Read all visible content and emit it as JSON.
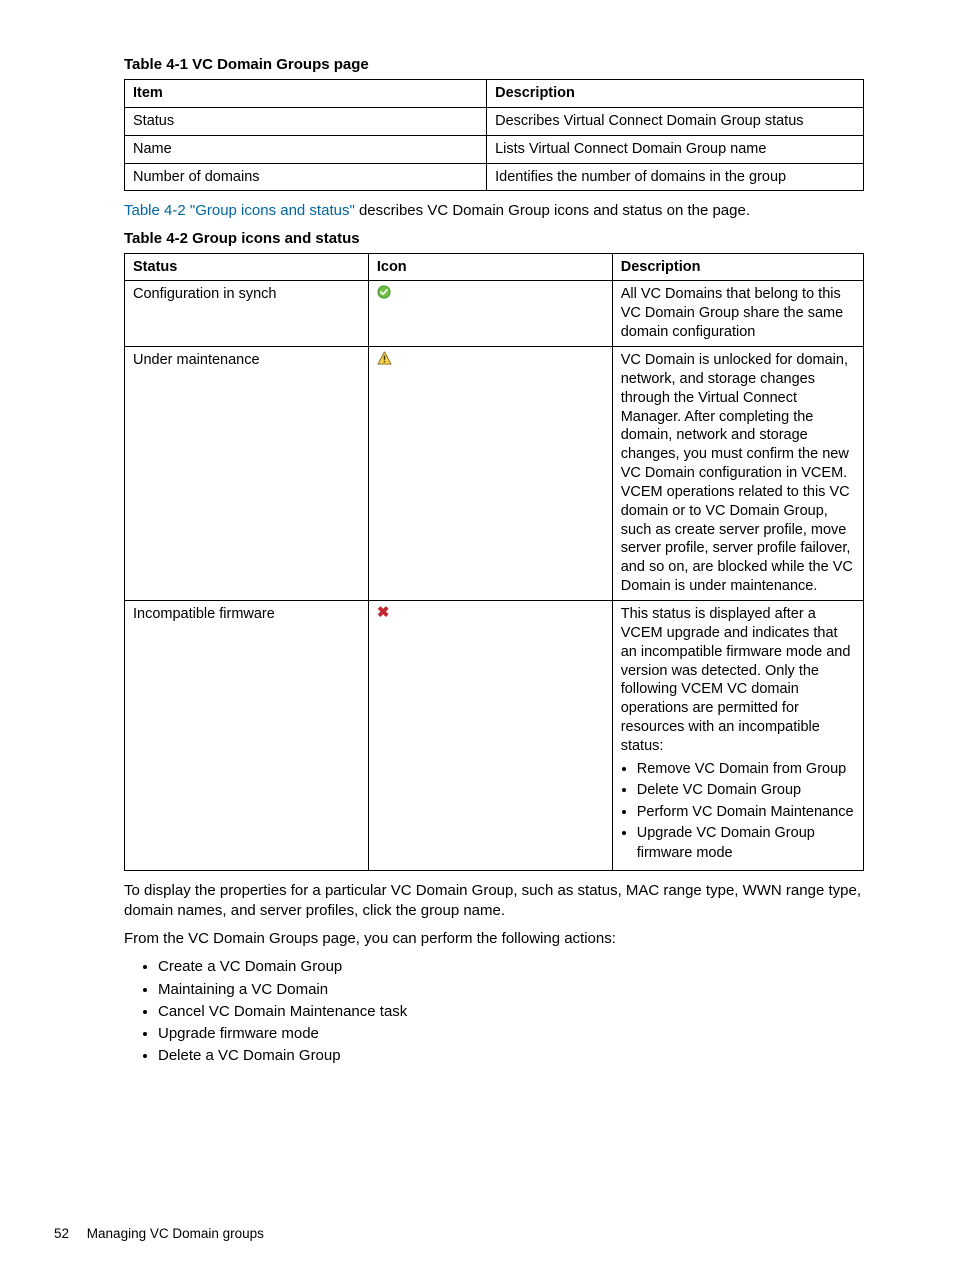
{
  "table1": {
    "caption": "Table 4-1 VC Domain Groups page",
    "headers": [
      "Item",
      "Description"
    ],
    "rows": [
      [
        "Status",
        "Describes Virtual Connect Domain Group status"
      ],
      [
        "Name",
        "Lists Virtual Connect Domain Group name"
      ],
      [
        "Number of domains",
        "Identifies the number of domains in the group"
      ]
    ]
  },
  "para1": {
    "link": "Table 4-2 \"Group icons and status\"",
    "rest": " describes VC Domain Group icons and status on the page."
  },
  "table2": {
    "caption": "Table 4-2 Group icons and status",
    "headers": [
      "Status",
      "Icon",
      "Description"
    ],
    "rows": [
      {
        "status": "Configuration in synch",
        "icon": "ok",
        "desc": "All VC Domains that belong to this VC Domain Group share the same domain configuration"
      },
      {
        "status": "Under maintenance",
        "icon": "warn",
        "desc": "VC Domain is unlocked for domain, network, and storage changes through the Virtual Connect Manager. After completing the domain, network and storage changes, you must confirm the new VC Domain configuration in VCEM. VCEM operations related to this VC domain or to VC Domain Group, such as create server profile, move server profile, server profile failover, and so on, are blocked while the VC Domain is under maintenance."
      },
      {
        "status": "Incompatible firmware",
        "icon": "x",
        "desc": "This status is displayed after a VCEM upgrade and indicates that an incompatible firmware mode and version was detected. Only the following VCEM VC domain operations are permitted for resources with an incompatible status:",
        "bullets": [
          "Remove VC Domain from Group",
          "Delete VC Domain Group",
          "Perform VC Domain Maintenance",
          "Upgrade VC Domain Group firmware mode"
        ]
      }
    ]
  },
  "para2": "To display the properties for a particular VC Domain Group, such as status, MAC range type, WWN range type, domain names, and server profiles, click the group name.",
  "para3": "From the VC Domain Groups page, you can perform the following actions:",
  "actions": [
    "Create a VC Domain Group",
    "Maintaining a VC Domain",
    "Cancel VC Domain Maintenance task",
    "Upgrade firmware mode",
    "Delete a VC Domain Group"
  ],
  "footer": {
    "page": "52",
    "chapter": "Managing VC Domain groups"
  }
}
